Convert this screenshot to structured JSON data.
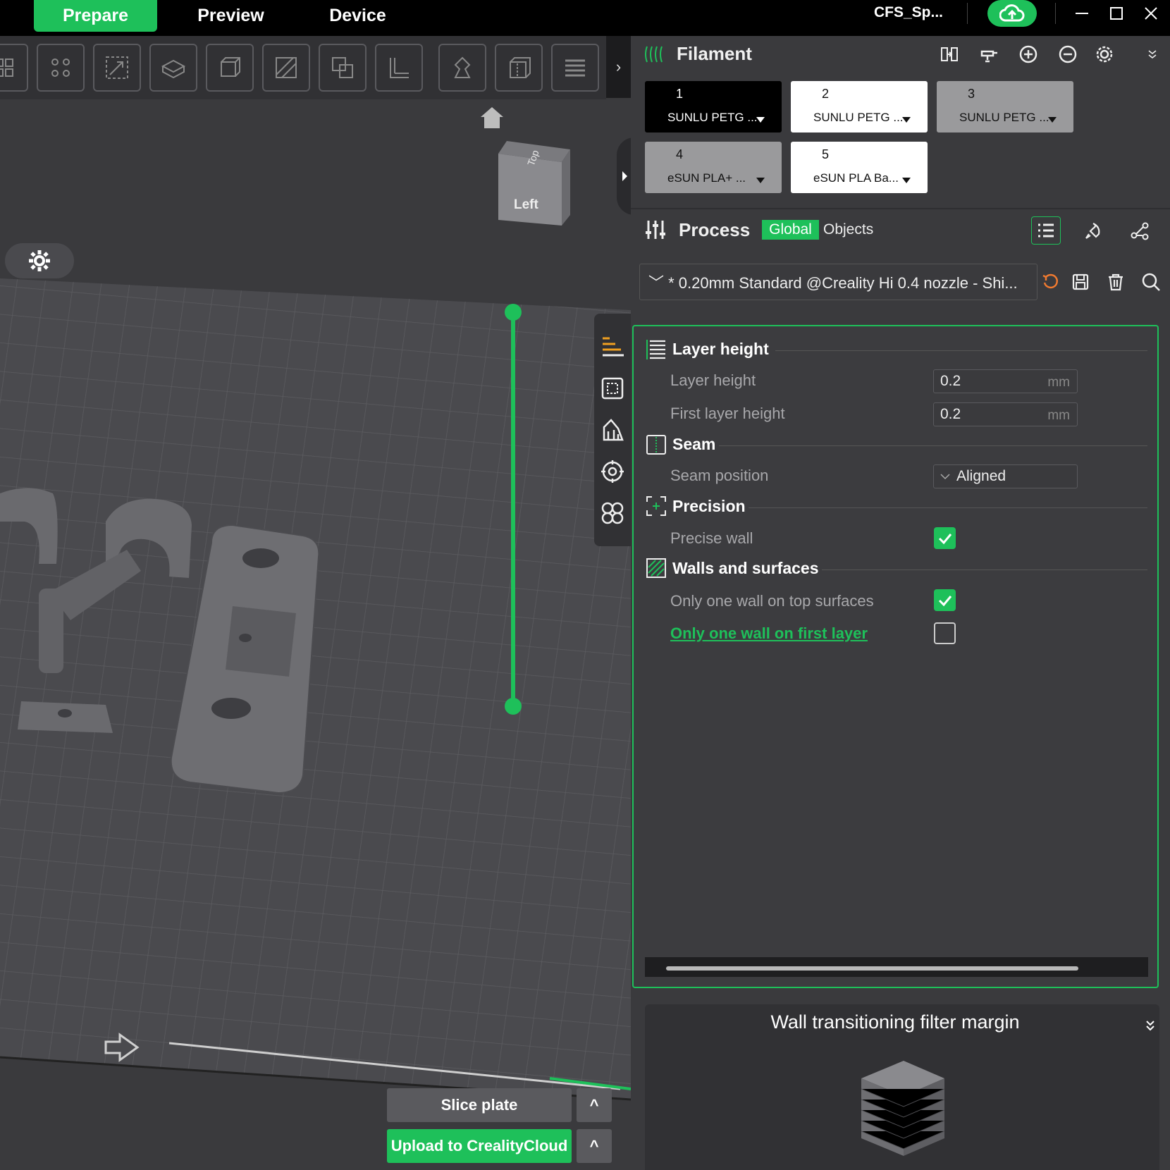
{
  "topbar": {
    "tabs": [
      "Prepare",
      "Preview",
      "Device"
    ],
    "printer_name": "CFS_Sp...",
    "icons": {
      "upload": "cloud-upload-icon",
      "minimize": "minimize-icon",
      "maximize": "maximize-icon",
      "close": "close-icon"
    }
  },
  "viewport": {
    "view_cube": {
      "top": "Top",
      "left": "Left"
    },
    "toolbar_collapse": "›"
  },
  "filament": {
    "title": "Filament",
    "slots": [
      {
        "num": "1",
        "name": "SUNLU PETG ...",
        "color": "#000000"
      },
      {
        "num": "2",
        "name": "SUNLU PETG ...",
        "color": "#ffffff"
      },
      {
        "num": "3",
        "name": "SUNLU PETG ...",
        "color": "#9a9a9c"
      },
      {
        "num": "4",
        "name": "eSUN PLA+ ...",
        "color": "#9a9a9c"
      },
      {
        "num": "5",
        "name": "eSUN PLA Ba...",
        "color": "#ffffff"
      }
    ]
  },
  "process": {
    "title": "Process",
    "tab_global": "Global",
    "tab_objects": "Objects",
    "preset": "﹀ * 0.20mm Standard @Creality Hi 0.4 nozzle - Shi...",
    "sections": {
      "layer_height": {
        "title": "Layer height",
        "layer_height_label": "Layer height",
        "layer_height_value": "0.2",
        "first_layer_label": "First layer height",
        "first_layer_value": "0.2",
        "unit": "mm"
      },
      "seam": {
        "title": "Seam",
        "position_label": "Seam position",
        "position_value": "Aligned"
      },
      "precision": {
        "title": "Precision",
        "precise_wall_label": "Precise wall",
        "precise_wall_checked": true
      },
      "walls": {
        "title": "Walls and surfaces",
        "top_label": "Only one wall on top surfaces",
        "top_checked": true,
        "first_label": "Only one wall on first layer",
        "first_checked": false
      }
    }
  },
  "tip": {
    "title": "Wall transitioning filter margin"
  },
  "actions": {
    "slice": "Slice plate",
    "upload": "Upload to CrealityCloud",
    "caret": "^"
  }
}
